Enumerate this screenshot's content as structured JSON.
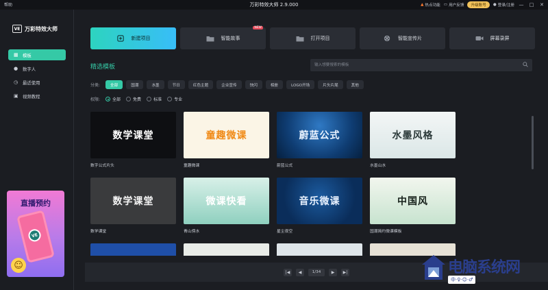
{
  "titlebar": {
    "help": "帮助",
    "title": "万彩特效大师 2.9.000",
    "hot": "热点功能",
    "feedback": "用户反馈",
    "upgrade": "升级账号",
    "login": "登录/注册",
    "minimize": "—",
    "maximize": "□",
    "close": "✕"
  },
  "sidebar": {
    "logo_box": "VE",
    "logo_text": "万彩特效大师",
    "items": [
      {
        "label": "模板",
        "icon": "template-icon"
      },
      {
        "label": "数字人",
        "icon": "digital-human-icon"
      },
      {
        "label": "最近使用",
        "icon": "recent-icon"
      },
      {
        "label": "视频教程",
        "icon": "tutorial-icon"
      }
    ],
    "promo_title": "直播预约",
    "promo_ve": "VE"
  },
  "actions": [
    {
      "label": "新建项目",
      "icon": "plus-icon"
    },
    {
      "label": "智能故事",
      "icon": "folder-icon",
      "badge": "NEW"
    },
    {
      "label": "打开项目",
      "icon": "folder-icon"
    },
    {
      "label": "智能宣传片",
      "icon": "film-reel-icon"
    },
    {
      "label": "屏幕录屏",
      "icon": "camera-icon"
    }
  ],
  "section_title": "精选模板",
  "search": {
    "placeholder": "输入想要搜索的模板"
  },
  "filters": {
    "label": "分类:",
    "chips": [
      "全部",
      "国潮",
      "水墨",
      "节日",
      "红色主题",
      "企业宣传",
      "快闪",
      "相册",
      "LOGO开场",
      "片头片尾",
      "其他"
    ],
    "active": "全部"
  },
  "perms": {
    "label": "权限:",
    "options": [
      "全部",
      "免费",
      "标准",
      "专业"
    ],
    "selected": "全部"
  },
  "templates": [
    {
      "label": "数字公式片头",
      "thumb_text": "数学课堂",
      "bg": "#0e0f12",
      "fg": "#ffffff"
    },
    {
      "label": "童趣微课",
      "thumb_text": "童趣微课",
      "bg": "#fbf5e6",
      "fg": "#f08a16"
    },
    {
      "label": "蔚蓝公式",
      "thumb_text": "蔚蓝公式",
      "bg": "#0f3d73",
      "fg": "#eaf3ff"
    },
    {
      "label": "水墨山水",
      "thumb_text": "水墨风格",
      "bg": "#e8f0f0",
      "fg": "#2c3a3a"
    },
    {
      "label": "数学课堂",
      "thumb_text": "数学课堂",
      "bg": "#3a3b3d",
      "fg": "#f3f3f3"
    },
    {
      "label": "青山傍水",
      "thumb_text": "微课快看",
      "bg": "#b9e0d8",
      "fg": "#ffffff"
    },
    {
      "label": "星尘夜空",
      "thumb_text": "音乐微课",
      "bg": "#0a2d5a",
      "fg": "#e9f2ff"
    },
    {
      "label": "国潮简约微课模板",
      "thumb_text": "中国风",
      "bg": "#e9f1e3",
      "fg": "#16201a"
    }
  ],
  "pager": {
    "first": "|◀",
    "prev": "◀",
    "page": "1/34",
    "next": "▶",
    "last": "▶|"
  },
  "watermark": {
    "text": "电脑系统网",
    "url": "中·♀·☺·♂"
  }
}
